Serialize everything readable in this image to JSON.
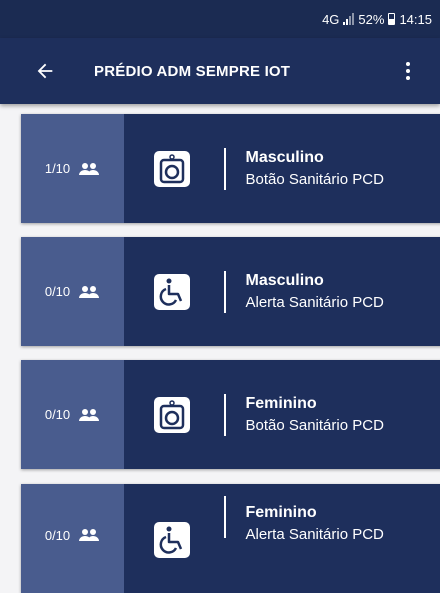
{
  "status_bar": {
    "network": "4G",
    "battery": "52%",
    "time": "14:15"
  },
  "app_bar": {
    "title": "PRÉDIO ADM SEMPRE IOT",
    "back_icon": "arrow-left-icon",
    "menu_icon": "more-vert-icon"
  },
  "cards": [
    {
      "count": "1/10",
      "title": "Masculino",
      "subtitle": "Botão Sanitário PCD",
      "icon": "button-sanitary-icon"
    },
    {
      "count": "0/10",
      "title": "Masculino",
      "subtitle": "Alerta Sanitário PCD",
      "icon": "wheelchair-icon"
    },
    {
      "count": "0/10",
      "title": "Feminino",
      "subtitle": "Botão Sanitário PCD",
      "icon": "button-sanitary-icon"
    },
    {
      "count": "0/10",
      "title": "Feminino",
      "subtitle": "Alerta Sanitário PCD",
      "icon": "wheelchair-icon"
    }
  ],
  "colors": {
    "primary": "#1e2f5c",
    "count_panel": "#495c8e",
    "background": "#f4f4f6"
  }
}
